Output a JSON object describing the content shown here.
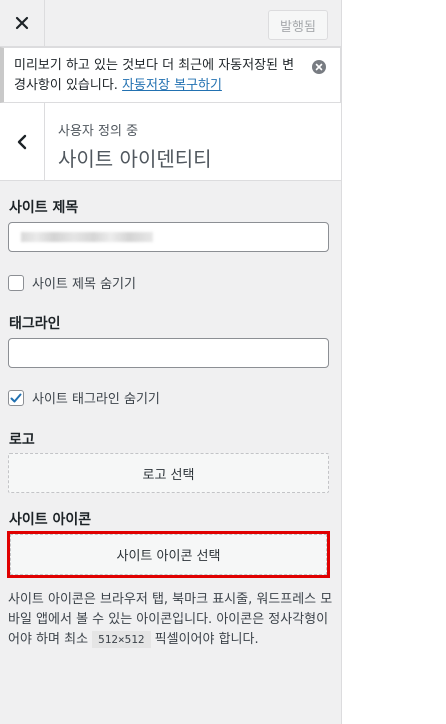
{
  "header": {
    "close_label": "close",
    "publish_label": "발행됨"
  },
  "notice": {
    "text": "미리보기 하고 있는 것보다 더 최근에 자동저장된 변경사항이 있습니다.",
    "link": "자동저장 복구하기"
  },
  "section": {
    "breadcrumb": "사용자 정의 중",
    "title": "사이트 아이덴티티"
  },
  "form": {
    "site_title_label": "사이트 제목",
    "site_title_value": "",
    "hide_title_label": "사이트 제목 숨기기",
    "hide_title_checked": false,
    "tagline_label": "태그라인",
    "tagline_value": "",
    "hide_tagline_label": "사이트 태그라인 숨기기",
    "hide_tagline_checked": true,
    "logo_label": "로고",
    "logo_button": "로고 선택",
    "site_icon_label": "사이트 아이콘",
    "site_icon_button": "사이트 아이콘 선택",
    "site_icon_desc_pre": "사이트 아이콘은 브라우저 탭, 북마크 표시줄, 워드프레스 모바일 앱에서 볼 수 있는 아이콘입니다. 아이콘은 정사각형이어야 하며 최소 ",
    "site_icon_desc_code": "512×512",
    "site_icon_desc_post": " 픽셀이어야 합니다."
  },
  "colors": {
    "accent": "#2271b1",
    "highlight": "#e00000",
    "checkbox_check": "#2271b1"
  }
}
